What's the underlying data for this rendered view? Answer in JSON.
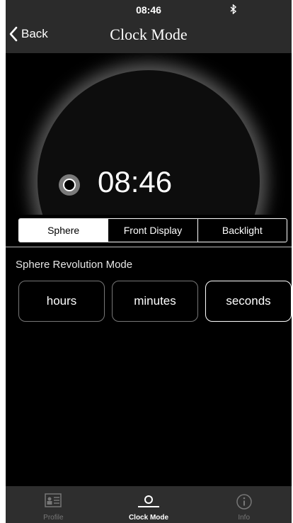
{
  "status_bar": {
    "time": "08:46",
    "bluetooth_icon": "bluetooth-icon"
  },
  "nav": {
    "back_label": "Back",
    "title": "Clock Mode"
  },
  "sphere": {
    "time": "08:46"
  },
  "segments": [
    {
      "label": "Sphere",
      "active": true
    },
    {
      "label": "Front Display",
      "active": false
    },
    {
      "label": "Backlight",
      "active": false
    }
  ],
  "revolution": {
    "label": "Sphere Revolution Mode",
    "options": [
      {
        "label": "hours",
        "active": false
      },
      {
        "label": "minutes",
        "active": false
      },
      {
        "label": "seconds",
        "active": true
      }
    ]
  },
  "tabs": [
    {
      "label": "Profile",
      "icon": "profile-icon",
      "active": false
    },
    {
      "label": "Clock Mode",
      "icon": "clock-mode-icon",
      "active": true
    },
    {
      "label": "Info",
      "icon": "info-icon",
      "active": false
    }
  ],
  "colors": {
    "background": "#000000",
    "header": "#2b2b2b",
    "tabbar": "#2e2e2e",
    "accent": "#ffffff"
  }
}
